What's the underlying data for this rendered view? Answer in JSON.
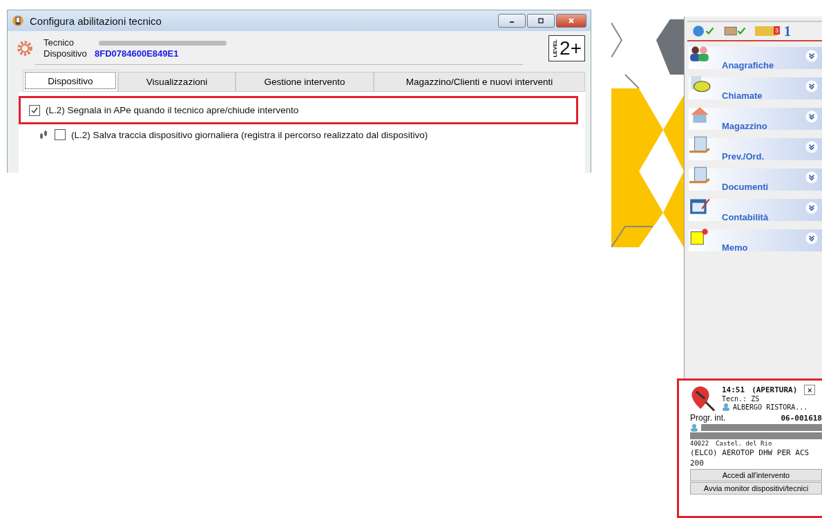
{
  "dialog": {
    "title": "Configura abilitazioni tecnico",
    "tecnico": {
      "label": "Tecnico",
      "redacted": true
    },
    "dispositivo": {
      "label": "Dispositivo",
      "value": "8FD0784600E849E1"
    },
    "level_badge": {
      "label": "LEVEL",
      "value": "2+"
    },
    "tabs": [
      {
        "label": "Dispositivo",
        "selected": true
      },
      {
        "label": "Visualizzazioni",
        "selected": false
      },
      {
        "label": "Gestione intervento",
        "selected": false
      },
      {
        "label": "Magazzino/Clienti e nuovi interventi",
        "selected": false
      }
    ],
    "options": [
      {
        "kind": "plain",
        "label": "(L.2) Segnala in APe quando il tecnico apre/chiude intervento",
        "checked": true,
        "highlighted": true
      },
      {
        "kind": "footprints",
        "label": "(L.2) Salva traccia dispositivo giornaliera (registra il percorso realizzato dal dispositivo)",
        "checked": false,
        "highlighted": false
      }
    ]
  },
  "sidebar": {
    "toolbar": {
      "badge": "3",
      "count": "1"
    },
    "items": [
      {
        "kind": "people",
        "label": "Anagrafiche"
      },
      {
        "kind": "phone",
        "label": "Chiamate"
      },
      {
        "kind": "house",
        "label": "Magazzino"
      },
      {
        "kind": "document",
        "label": "Prev./Ord."
      },
      {
        "kind": "document",
        "label": "Documenti"
      },
      {
        "kind": "ledger",
        "label": "Contabilità"
      },
      {
        "kind": "memo",
        "label": "Memo"
      }
    ]
  },
  "notification": {
    "time": "14:51",
    "status": "(APERTURA)",
    "close": "×",
    "tech": "Tecn.: ZS",
    "client": "ALBERGO RISTORA...",
    "progr_label": "Progr. int.",
    "progr_value": "06-001618",
    "zip": "40022",
    "city": "Castel. del Rio",
    "description": "(ELCO) AEROTOP DHW PER ACS 200",
    "buttons": [
      "Accedi all'intervento",
      "Avvia monitor dispositivi/tecnici"
    ]
  }
}
